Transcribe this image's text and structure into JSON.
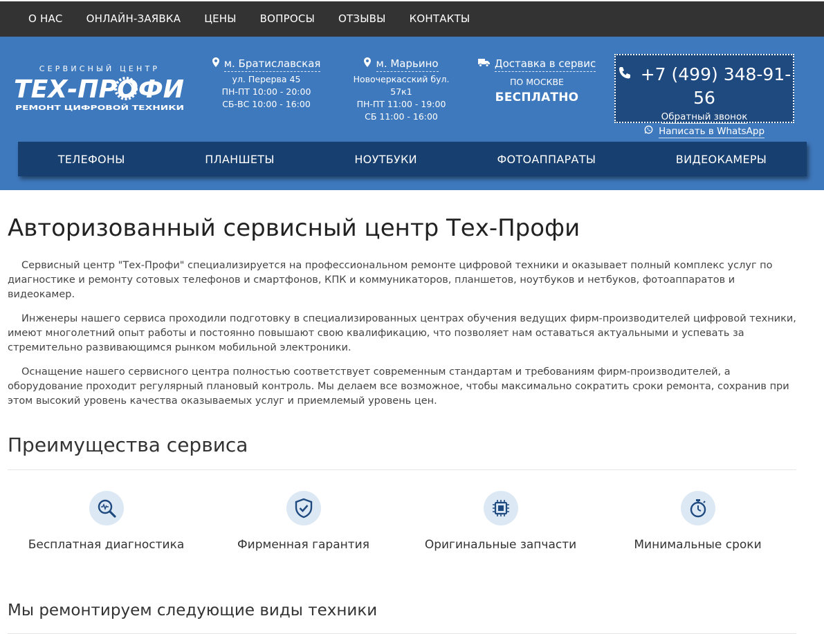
{
  "top_nav": [
    "О НАС",
    "ОНЛАЙН-ЗАЯВКА",
    "ЦЕНЫ",
    "ВОПРОСЫ",
    "ОТЗЫВЫ",
    "КОНТАКТЫ"
  ],
  "logo": {
    "top": "СЕРВИСНЫЙ ЦЕНТР",
    "main": "ТЕХ-ПРОФИ",
    "bottom": "РЕМОНТ ЦИФРОВОЙ ТЕХНИКИ"
  },
  "locations": [
    {
      "name": "м. Братиславская",
      "lines": [
        "ул. Перерва 45",
        "ПН-ПТ 10:00 - 20:00",
        "СБ-ВС 10:00 - 16:00"
      ]
    },
    {
      "name": "м. Марьино",
      "lines": [
        "Новочеркасский бул.",
        "57к1",
        "ПН-ПТ 11:00 - 19:00",
        "СБ 11:00 - 16:00"
      ]
    }
  ],
  "delivery": {
    "title": "Доставка в сервис",
    "sub": "ПО МОСКВЕ",
    "big": "БЕСПЛАТНО"
  },
  "contact": {
    "phone": "+7 (499) 348-91-56",
    "callback": "Обратный звонок",
    "whatsapp": "Написать в WhatsApp"
  },
  "categories": [
    "ТЕЛЕФОНЫ",
    "ПЛАНШЕТЫ",
    "НОУТБУКИ",
    "ФОТОАППАРАТЫ",
    "ВИДЕОКАМЕРЫ"
  ],
  "main": {
    "title": "Авторизованный сервисный центр Тех-Профи",
    "paragraphs": [
      "Сервисный центр \"Тех-Профи\" специализируется на профессиональном ремонте цифровой техники и оказывает полный комплекс услуг по диагностике и ремонту сотовых телефонов и смартфонов, КПК и коммуникаторов, планшетов, ноутбуков и нетбуков, фотоаппаратов и видеокамер.",
      "Инженеры нашего сервиса проходили подготовку в специализированных центрах обучения ведущих фирм-производителей цифровой техники, имеют многолетний опыт работы и постоянно повышают свою квалификацию, что позволяет нам оставаться актуальными и успевать за стремительно развивающимся рынком мобильной электроники.",
      "Оснащение нашего сервисного центра полностью соответствует современным стандартам и требованиям фирм-производителей, а оборудование проходит регулярный плановый контроль. Мы делаем все возможное, чтобы максимально сократить сроки ремонта, сохранив при этом высокий уровень качества оказываемых услуг и приемлемый уровень цен."
    ],
    "advantages_title": "Преимущества сервиса",
    "advantages": [
      {
        "label": "Бесплатная диагностика",
        "icon": "diagnostics-icon"
      },
      {
        "label": "Фирменная гарантия",
        "icon": "shield-check-icon"
      },
      {
        "label": "Оригинальные запчасти",
        "icon": "chip-icon"
      },
      {
        "label": "Минимальные сроки",
        "icon": "stopwatch-icon"
      }
    ],
    "repair_title": "Мы ремонтируем следующие виды техники"
  },
  "colors": {
    "top_nav_bg": "#333333",
    "header_bg": "#3f79bd",
    "category_nav_bg": "#173f6f",
    "icon_circle_bg": "#dce8f4",
    "icon_color": "#1f4a80"
  }
}
